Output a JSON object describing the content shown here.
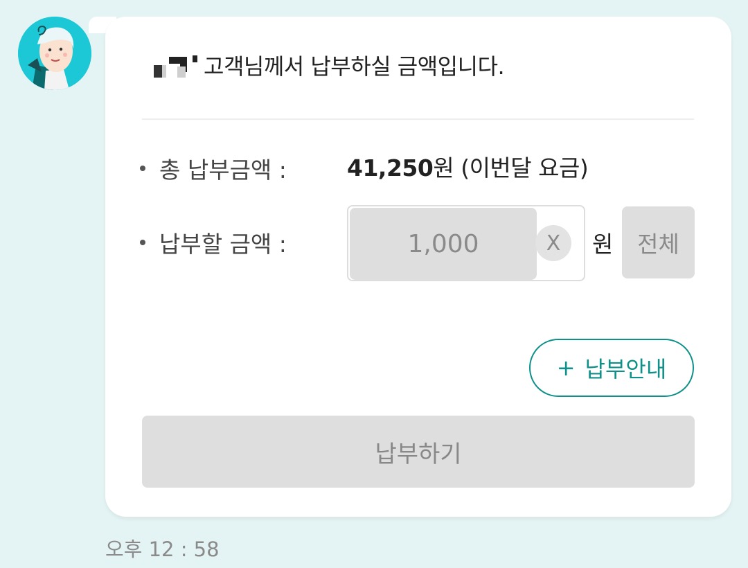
{
  "message": {
    "title_text": "고객님께서 납부하실 금액입니다.",
    "total_label": "총 납부금액 :",
    "total_amount": "41,250",
    "total_suffix": "원 (이번달 요금)",
    "pay_amount_label": "납부할 금액 :",
    "pay_amount_value": "1,000",
    "clear_label": "X",
    "currency_label": "원",
    "all_label": "전체",
    "guide_plus": "+",
    "guide_label": "납부안내",
    "pay_button_label": "납부하기"
  },
  "timestamp": "오후 12 : 58",
  "colors": {
    "background": "#e4f3f3",
    "accent": "#0f9089",
    "disabled": "#dedede"
  },
  "icons": {
    "avatar": "agent-avatar-icon",
    "clear": "clear-icon",
    "plus": "plus-icon"
  }
}
